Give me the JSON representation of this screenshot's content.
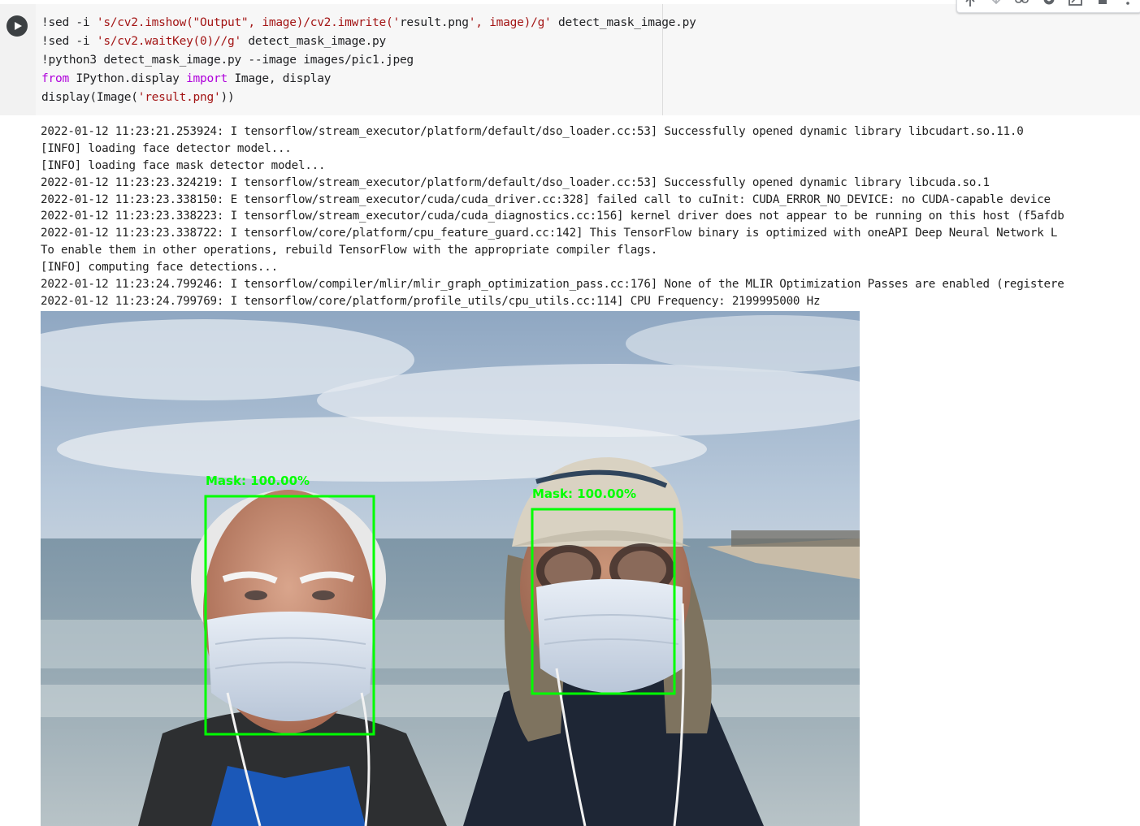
{
  "cell": {
    "run_button_label": "Run cell",
    "code_lines": [
      [
        {
          "t": "!sed -i ",
          "c": ""
        },
        {
          "t": "'s/cv2.imshow(\"Output\", image)/cv2.imwrite('",
          "c": "str"
        },
        {
          "t": "result.png",
          "c": ""
        },
        {
          "t": "', image)/g'",
          "c": "str"
        },
        {
          "t": " detect_mask_image.py",
          "c": ""
        }
      ],
      [
        {
          "t": "!sed -i ",
          "c": ""
        },
        {
          "t": "'s/cv2.waitKey(0)//g'",
          "c": "str"
        },
        {
          "t": " detect_mask_image.py",
          "c": ""
        }
      ],
      [
        {
          "t": "!python3 detect_mask_image.py --image images/pic1.jpeg",
          "c": ""
        }
      ],
      [
        {
          "t": "from",
          "c": "kw"
        },
        {
          "t": " IPython.display ",
          "c": ""
        },
        {
          "t": "import",
          "c": "kw"
        },
        {
          "t": " Image, display",
          "c": ""
        }
      ],
      [
        {
          "t": "display(Image(",
          "c": ""
        },
        {
          "t": "'result.png'",
          "c": "str"
        },
        {
          "t": "))",
          "c": ""
        }
      ]
    ]
  },
  "toolbar": {
    "icons": [
      "arrow-up-icon",
      "arrow-down-icon",
      "link-icon",
      "settings-icon",
      "mirror-cell-icon",
      "delete-icon",
      "more-vert-icon"
    ]
  },
  "output": {
    "log_lines": [
      "2022-01-12 11:23:21.253924: I tensorflow/stream_executor/platform/default/dso_loader.cc:53] Successfully opened dynamic library libcudart.so.11.0",
      "[INFO] loading face detector model...",
      "[INFO] loading face mask detector model...",
      "2022-01-12 11:23:23.324219: I tensorflow/stream_executor/platform/default/dso_loader.cc:53] Successfully opened dynamic library libcuda.so.1",
      "2022-01-12 11:23:23.338150: E tensorflow/stream_executor/cuda/cuda_driver.cc:328] failed call to cuInit: CUDA_ERROR_NO_DEVICE: no CUDA-capable device",
      "2022-01-12 11:23:23.338223: I tensorflow/stream_executor/cuda/cuda_diagnostics.cc:156] kernel driver does not appear to be running on this host (f5afdb",
      "2022-01-12 11:23:23.338722: I tensorflow/core/platform/cpu_feature_guard.cc:142] This TensorFlow binary is optimized with oneAPI Deep Neural Network L",
      "To enable them in other operations, rebuild TensorFlow with the appropriate compiler flags.",
      "[INFO] computing face detections...",
      "2022-01-12 11:23:24.799246: I tensorflow/compiler/mlir/mlir_graph_optimization_pass.cc:176] None of the MLIR Optimization Passes are enabled (registere",
      "2022-01-12 11:23:24.799769: I tensorflow/core/platform/profile_utils/cpu_utils.cc:114] CPU Frequency: 2199995000 Hz"
    ]
  },
  "result_image": {
    "detections": [
      {
        "label": "Mask: 100.00%"
      },
      {
        "label": "Mask: 100.00%"
      }
    ],
    "box_color": "#00ff00"
  },
  "colors": {
    "string": "#a31515",
    "keyword": "#af00db",
    "gutter": "#f2f2f2",
    "editor_bg": "#f7f7f7"
  }
}
